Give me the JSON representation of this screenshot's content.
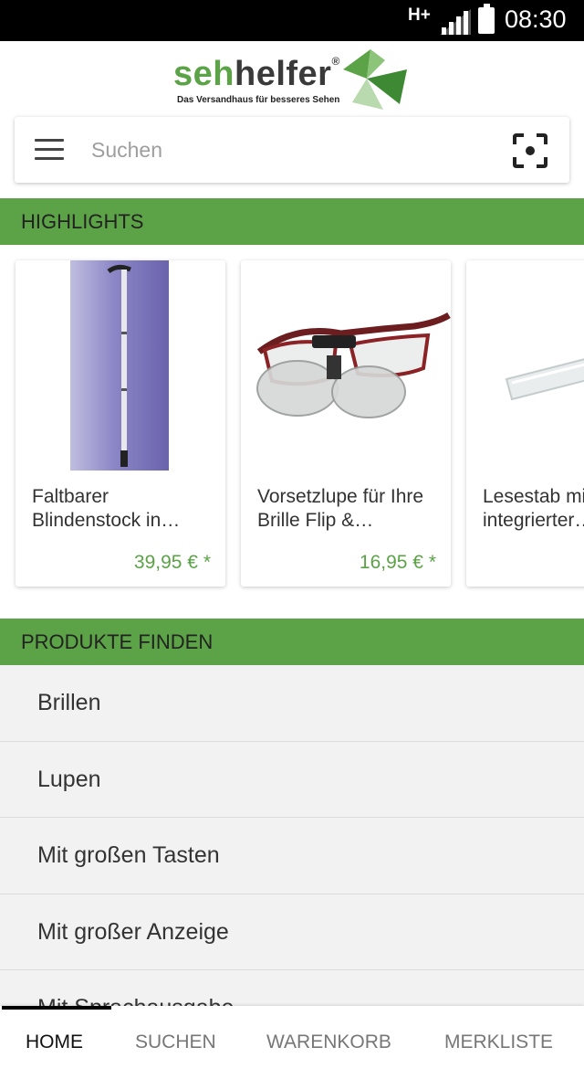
{
  "status_bar": {
    "network": "H+",
    "time": "08:30"
  },
  "logo": {
    "brand_part1": "seh",
    "brand_part2": "helfer",
    "registered": "®",
    "tagline": "Das Versandhaus für besseres Sehen"
  },
  "search": {
    "placeholder": "Suchen",
    "value": ""
  },
  "highlights": {
    "title": "HIGHLIGHTS",
    "products": [
      {
        "title": "Faltbarer Blindenstock in…",
        "price": "39,95 € *",
        "image": "white-cane"
      },
      {
        "title": "Vorsetzlupe für Ihre Brille Flip &…",
        "price": "16,95 € *",
        "image": "clip-on-magnifier-glasses"
      },
      {
        "title": "Lesestab mit integrierter…",
        "price": "",
        "image": "reading-rod"
      }
    ]
  },
  "find_products": {
    "title": "PRODUKTE FINDEN",
    "items": [
      "Brillen",
      "Lupen",
      "Mit großen Tasten",
      "Mit großer Anzeige",
      "Mit Sprachausgabe"
    ]
  },
  "bottom_nav": {
    "tabs": [
      "HOME",
      "SUCHEN",
      "WARENKORB",
      "MERKLISTE"
    ],
    "active": "HOME"
  },
  "colors": {
    "accent": "#5ba346",
    "status_bar": "#000000",
    "list_bg": "#f2f2f2"
  }
}
